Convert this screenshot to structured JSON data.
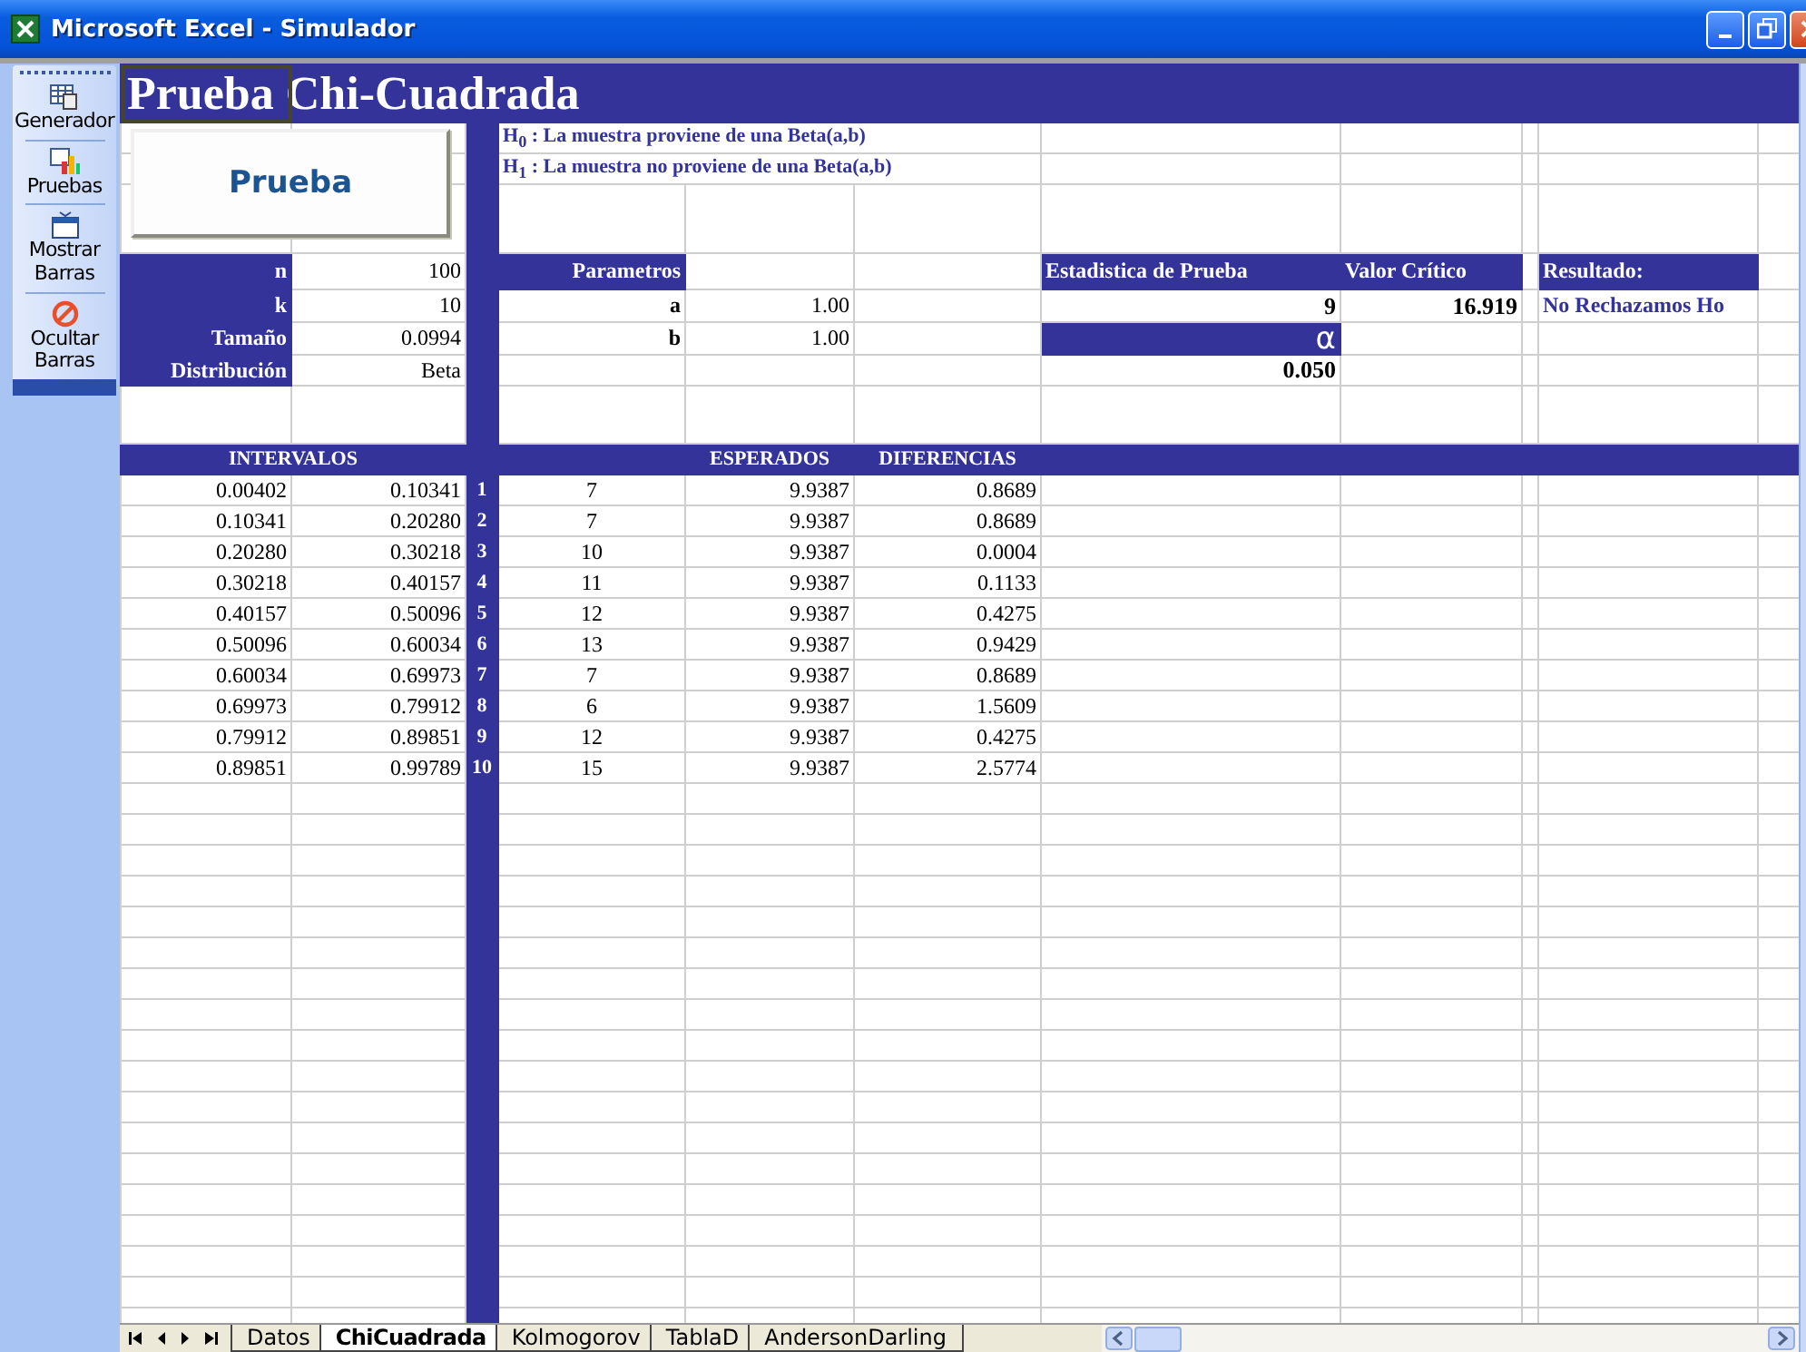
{
  "window": {
    "title": "Microsoft Excel - Simulador"
  },
  "toolbar": [
    {
      "label": "Generador",
      "kind": "grid"
    },
    {
      "label": "Pruebas",
      "kind": "chart"
    },
    {
      "label": "Mostrar Barras",
      "kind": "window"
    },
    {
      "label": "Ocultar Barras",
      "kind": "ban"
    }
  ],
  "sheet_title": "Prueba Chi-Cuadrada",
  "button": {
    "label": "Prueba"
  },
  "hypotheses": [
    "H$_{0}$ : La muestra proviene de una Beta(a,b)",
    "H$_{1}$ : La muestra no proviene de una Beta(a,b)"
  ],
  "inputs": [
    {
      "label": "n",
      "value": "100"
    },
    {
      "label": "k",
      "value": "10"
    },
    {
      "label": "Tamaño",
      "value": "0.0994"
    },
    {
      "label": "Distribución",
      "value": "Beta"
    }
  ],
  "params": {
    "header": "Parametros",
    "rows": [
      {
        "label": "a",
        "value": "1.00"
      },
      {
        "label": "b",
        "value": "1.00"
      }
    ]
  },
  "statistic": {
    "header": "Estadistica de Prueba",
    "value": "9"
  },
  "critical": {
    "header": "Valor Crítico",
    "value": "16.919"
  },
  "result": {
    "header": "Resultado:",
    "value": "No Rechazamos Ho"
  },
  "alpha": {
    "label": "α",
    "value": "0.050"
  },
  "table": {
    "headers": {
      "intervals": "INTERVALOS",
      "expected": "ESPERADOS",
      "differences": "DIFERENCIAS"
    },
    "rows": [
      {
        "from": "0.00402",
        "to": "0.10341",
        "index": "1",
        "observed": "7",
        "expected": "9.9387",
        "difference": "0.8689"
      },
      {
        "from": "0.10341",
        "to": "0.20280",
        "index": "2",
        "observed": "7",
        "expected": "9.9387",
        "difference": "0.8689"
      },
      {
        "from": "0.20280",
        "to": "0.30218",
        "index": "3",
        "observed": "10",
        "expected": "9.9387",
        "difference": "0.0004"
      },
      {
        "from": "0.30218",
        "to": "0.40157",
        "index": "4",
        "observed": "11",
        "expected": "9.9387",
        "difference": "0.1133"
      },
      {
        "from": "0.40157",
        "to": "0.50096",
        "index": "5",
        "observed": "12",
        "expected": "9.9387",
        "difference": "0.4275"
      },
      {
        "from": "0.50096",
        "to": "0.60034",
        "index": "6",
        "observed": "13",
        "expected": "9.9387",
        "difference": "0.9429"
      },
      {
        "from": "0.60034",
        "to": "0.69973",
        "index": "7",
        "observed": "7",
        "expected": "9.9387",
        "difference": "0.8689"
      },
      {
        "from": "0.69973",
        "to": "0.79912",
        "index": "8",
        "observed": "6",
        "expected": "9.9387",
        "difference": "1.5609"
      },
      {
        "from": "0.79912",
        "to": "0.89851",
        "index": "9",
        "observed": "12",
        "expected": "9.9387",
        "difference": "0.4275"
      },
      {
        "from": "0.89851",
        "to": "0.99789",
        "index": "10",
        "observed": "15",
        "expected": "9.9387",
        "difference": "2.5774"
      }
    ]
  },
  "sheet_tabs": [
    {
      "label": "Datos",
      "selected": false
    },
    {
      "label": "ChiCuadrada",
      "selected": true
    },
    {
      "label": "Kolmogorov",
      "selected": false
    },
    {
      "label": "TablaD",
      "selected": false
    },
    {
      "label": "AndersonDarling",
      "selected": false
    }
  ]
}
